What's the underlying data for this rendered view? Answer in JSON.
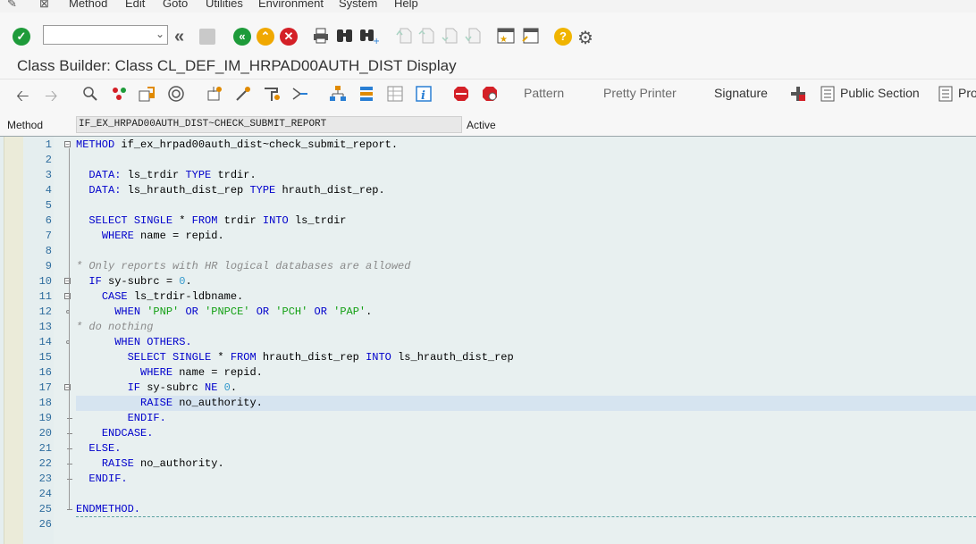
{
  "menubar": {
    "items": [
      "Method",
      "Edit",
      "Goto",
      "Utilities",
      "Environment",
      "System",
      "Help"
    ]
  },
  "std_toolbar": {
    "command_field_value": "",
    "icons": [
      "enter-icon",
      "back-icon",
      "save-icon",
      "back-green-icon",
      "exit-icon",
      "cancel-icon",
      "print-icon",
      "find-icon",
      "find-next-icon",
      "first-page-icon",
      "previous-page-icon",
      "next-page-icon",
      "last-page-icon",
      "create-session-icon",
      "shortcut-icon",
      "help-icon",
      "customize-layout-icon"
    ]
  },
  "title": "Class Builder: Class CL_DEF_IM_HRPAD00AUTH_DIST Display",
  "app_toolbar": {
    "pattern": "Pattern",
    "pretty_printer": "Pretty Printer",
    "signature": "Signature",
    "public_section": "Public Section",
    "pro_truncated": "Pro"
  },
  "method_header": {
    "label": "Method",
    "value": "IF_EX_HRPAD00AUTH_DIST~CHECK_SUBMIT_REPORT",
    "status": "Active"
  },
  "editor": {
    "line_numbers": [
      "1",
      "2",
      "3",
      "4",
      "5",
      "6",
      "7",
      "8",
      "9",
      "10",
      "11",
      "12",
      "13",
      "14",
      "15",
      "16",
      "17",
      "18",
      "19",
      "20",
      "21",
      "22",
      "23",
      "24",
      "25",
      "26"
    ],
    "highlighted_line": 18,
    "colors": {
      "keyword": "#0000cc",
      "string": "#14a014",
      "number": "#3399cc",
      "comment": "#8a8a8a",
      "line_number": "#2f6d9e"
    },
    "lines": [
      [
        {
          "t": "METHOD",
          "c": "kw"
        },
        {
          "t": " if_ex_hrpad00auth_dist~check_submit_report."
        }
      ],
      [],
      [
        {
          "t": "  "
        },
        {
          "t": "DATA:",
          "c": "kw"
        },
        {
          "t": " ls_trdir "
        },
        {
          "t": "TYPE",
          "c": "kw"
        },
        {
          "t": " trdir."
        }
      ],
      [
        {
          "t": "  "
        },
        {
          "t": "DATA:",
          "c": "kw"
        },
        {
          "t": " ls_hrauth_dist_rep "
        },
        {
          "t": "TYPE",
          "c": "kw"
        },
        {
          "t": " hrauth_dist_rep."
        }
      ],
      [],
      [
        {
          "t": "  "
        },
        {
          "t": "SELECT SINGLE",
          "c": "kw"
        },
        {
          "t": " * "
        },
        {
          "t": "FROM",
          "c": "kw"
        },
        {
          "t": " trdir "
        },
        {
          "t": "INTO",
          "c": "kw"
        },
        {
          "t": " ls_trdir"
        }
      ],
      [
        {
          "t": "    "
        },
        {
          "t": "WHERE",
          "c": "kw"
        },
        {
          "t": " name = repid."
        }
      ],
      [],
      [
        {
          "t": "* Only reports with HR logical databases are allowed",
          "c": "cmt"
        }
      ],
      [
        {
          "t": "  "
        },
        {
          "t": "IF",
          "c": "kw"
        },
        {
          "t": " sy-subrc = "
        },
        {
          "t": "0",
          "c": "num-lit"
        },
        {
          "t": "."
        }
      ],
      [
        {
          "t": "    "
        },
        {
          "t": "CASE",
          "c": "kw"
        },
        {
          "t": " ls_trdir-ldbname."
        }
      ],
      [
        {
          "t": "      "
        },
        {
          "t": "WHEN",
          "c": "kw"
        },
        {
          "t": " "
        },
        {
          "t": "'PNP'",
          "c": "str"
        },
        {
          "t": " "
        },
        {
          "t": "OR",
          "c": "kw"
        },
        {
          "t": " "
        },
        {
          "t": "'PNPCE'",
          "c": "str"
        },
        {
          "t": " "
        },
        {
          "t": "OR",
          "c": "kw"
        },
        {
          "t": " "
        },
        {
          "t": "'PCH'",
          "c": "str"
        },
        {
          "t": " "
        },
        {
          "t": "OR",
          "c": "kw"
        },
        {
          "t": " "
        },
        {
          "t": "'PAP'",
          "c": "str"
        },
        {
          "t": "."
        }
      ],
      [
        {
          "t": "* do nothing",
          "c": "cmt"
        }
      ],
      [
        {
          "t": "      "
        },
        {
          "t": "WHEN OTHERS.",
          "c": "kw"
        }
      ],
      [
        {
          "t": "        "
        },
        {
          "t": "SELECT SINGLE",
          "c": "kw"
        },
        {
          "t": " * "
        },
        {
          "t": "FROM",
          "c": "kw"
        },
        {
          "t": " hrauth_dist_rep "
        },
        {
          "t": "INTO",
          "c": "kw"
        },
        {
          "t": " ls_hrauth_dist_rep"
        }
      ],
      [
        {
          "t": "          "
        },
        {
          "t": "WHERE",
          "c": "kw"
        },
        {
          "t": " name = repid."
        }
      ],
      [
        {
          "t": "        "
        },
        {
          "t": "IF",
          "c": "kw"
        },
        {
          "t": " sy-subrc "
        },
        {
          "t": "NE",
          "c": "kw"
        },
        {
          "t": " "
        },
        {
          "t": "0",
          "c": "num-lit"
        },
        {
          "t": "."
        }
      ],
      [
        {
          "t": "          "
        },
        {
          "t": "RAISE",
          "c": "kw"
        },
        {
          "t": " no_authority."
        }
      ],
      [
        {
          "t": "        "
        },
        {
          "t": "ENDIF.",
          "c": "kw"
        }
      ],
      [
        {
          "t": "    "
        },
        {
          "t": "ENDCASE.",
          "c": "kw"
        }
      ],
      [
        {
          "t": "  "
        },
        {
          "t": "ELSE.",
          "c": "kw"
        }
      ],
      [
        {
          "t": "    "
        },
        {
          "t": "RAISE",
          "c": "kw"
        },
        {
          "t": " no_authority."
        }
      ],
      [
        {
          "t": "  "
        },
        {
          "t": "ENDIF.",
          "c": "kw"
        }
      ],
      [],
      [
        {
          "t": "ENDMETHOD.",
          "c": "kw"
        }
      ],
      []
    ]
  }
}
